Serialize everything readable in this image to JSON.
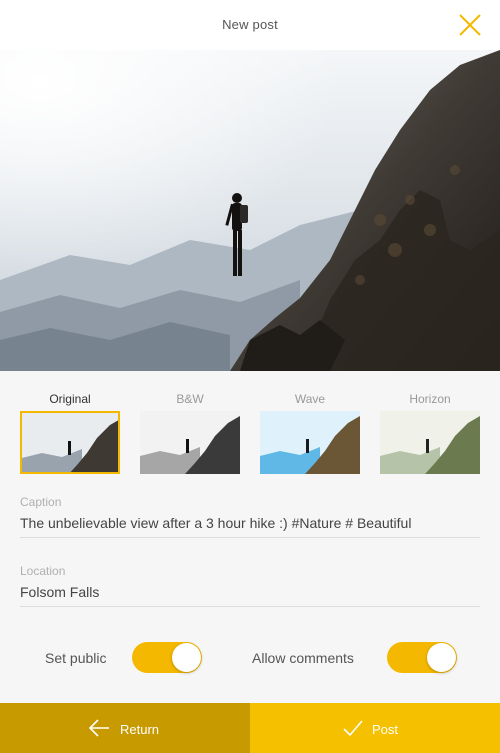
{
  "header": {
    "title": "New post",
    "close_icon": "close-icon"
  },
  "filters": [
    {
      "label": "Original",
      "selected": true
    },
    {
      "label": "B&W",
      "selected": false
    },
    {
      "label": "Wave",
      "selected": false
    },
    {
      "label": "Horizon",
      "selected": false
    }
  ],
  "caption": {
    "label": "Caption",
    "value": "The unbelievable view after a 3 hour hike :) #Nature # Beautiful"
  },
  "location": {
    "label": "Location",
    "value": "Folsom Falls"
  },
  "toggles": {
    "public": {
      "label": "Set public",
      "on": true
    },
    "comments": {
      "label": "Allow comments",
      "on": true
    }
  },
  "actions": {
    "return_label": "Return",
    "return_icon": "arrow-left-icon",
    "post_label": "Post",
    "post_icon": "checkmark-icon"
  },
  "colors": {
    "accent": "#f5c000",
    "accent_dark": "#c79a00"
  }
}
